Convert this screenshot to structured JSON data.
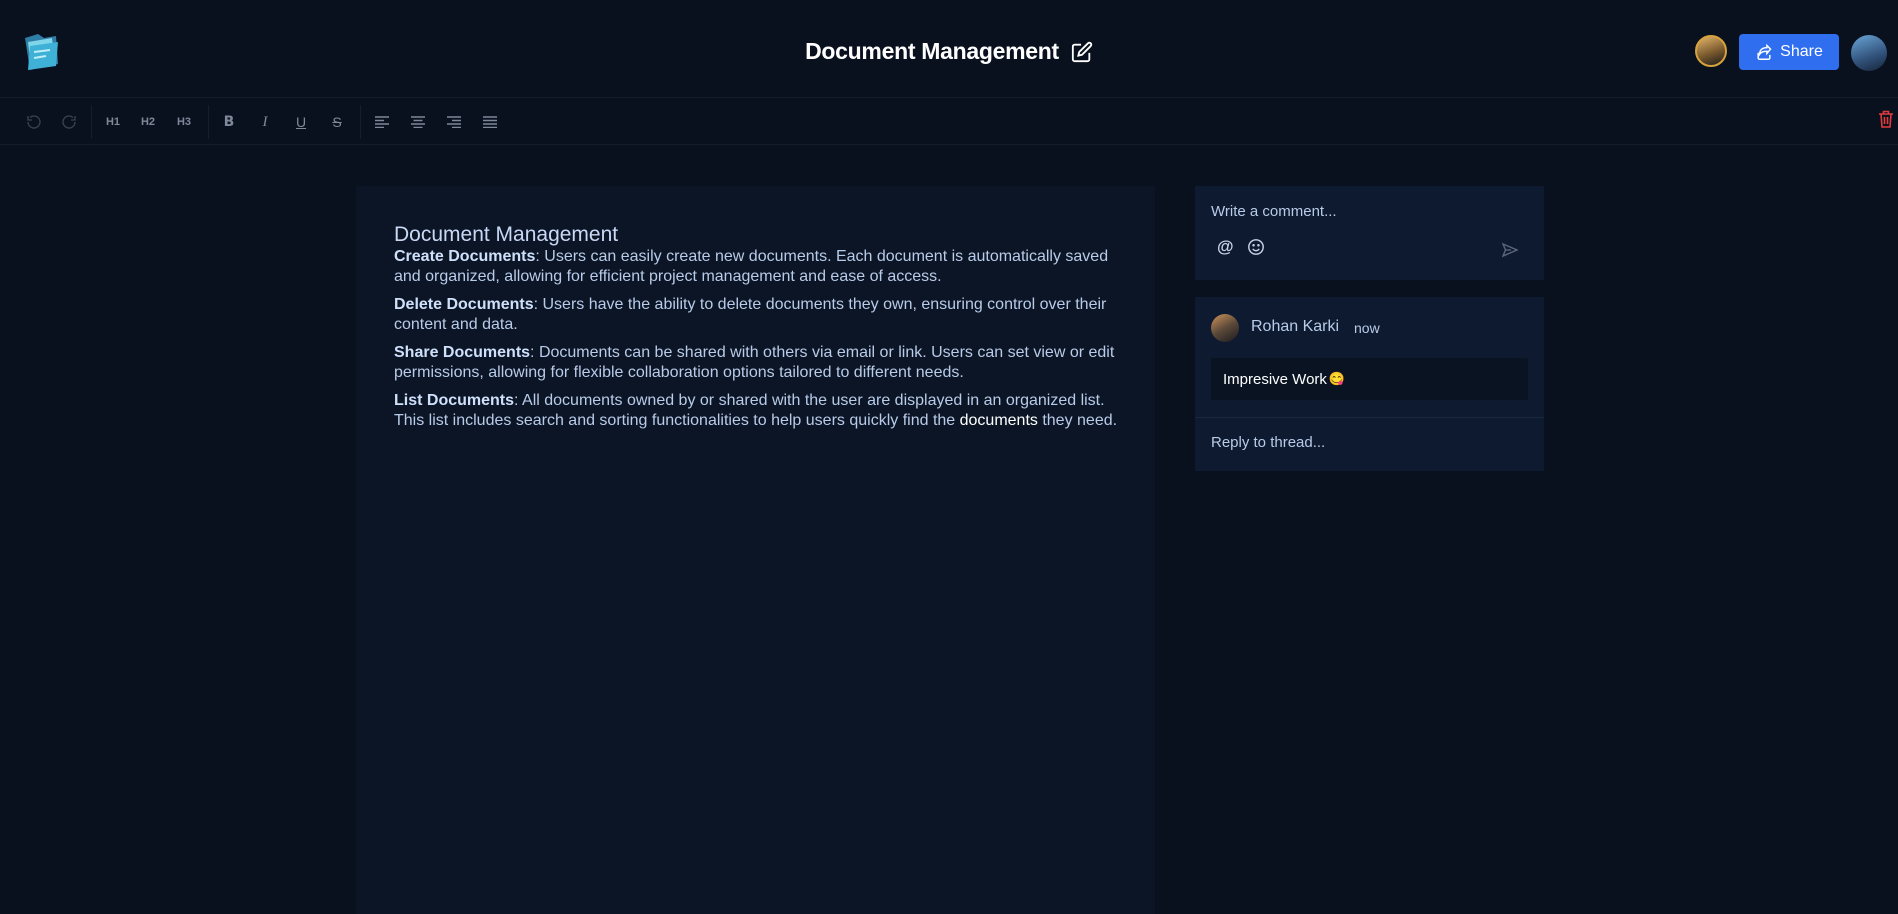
{
  "header": {
    "title": "Document Management",
    "share_label": "Share"
  },
  "toolbar": {
    "items": [
      "undo",
      "redo",
      "H1",
      "H2",
      "H3",
      "B",
      "I",
      "U",
      "S",
      "align-left",
      "align-center",
      "align-right",
      "align-justify"
    ],
    "h1": "H1",
    "h2": "H2",
    "h3": "H3",
    "bold": "B",
    "italic": "I",
    "underline": "U",
    "strike": "S"
  },
  "document": {
    "heading": "Document Management",
    "paragraphs": [
      {
        "bold": "Create Documents",
        "text": ": Users can easily create new documents. Each document is automatically saved and organized, allowing for efficient project management and ease of access."
      },
      {
        "bold": "Delete Documents",
        "text": ": Users have the ability to delete documents they own, ensuring control over their content and data."
      },
      {
        "bold": "Share Documents",
        "text": ": Documents can be shared with others via email or link. Users can set view or edit permissions, allowing for flexible collaboration options tailored to different needs."
      },
      {
        "bold": "List Documents",
        "text_before": ": All documents owned by or shared with the user are displayed in an organized list. This list includes search and sorting functionalities to help users quickly find the ",
        "highlight": "documents",
        "text_after": " they need."
      }
    ]
  },
  "comments": {
    "placeholder": "Write a comment...",
    "mention_symbol": "@",
    "thread": {
      "author": "Rohan Karki",
      "time": "now",
      "body": "Impresive Work",
      "emoji": "😋",
      "reply_placeholder": "Reply to thread..."
    }
  },
  "colors": {
    "background": "#09111f",
    "accent": "#2f6fef",
    "danger": "#e23b3b"
  }
}
